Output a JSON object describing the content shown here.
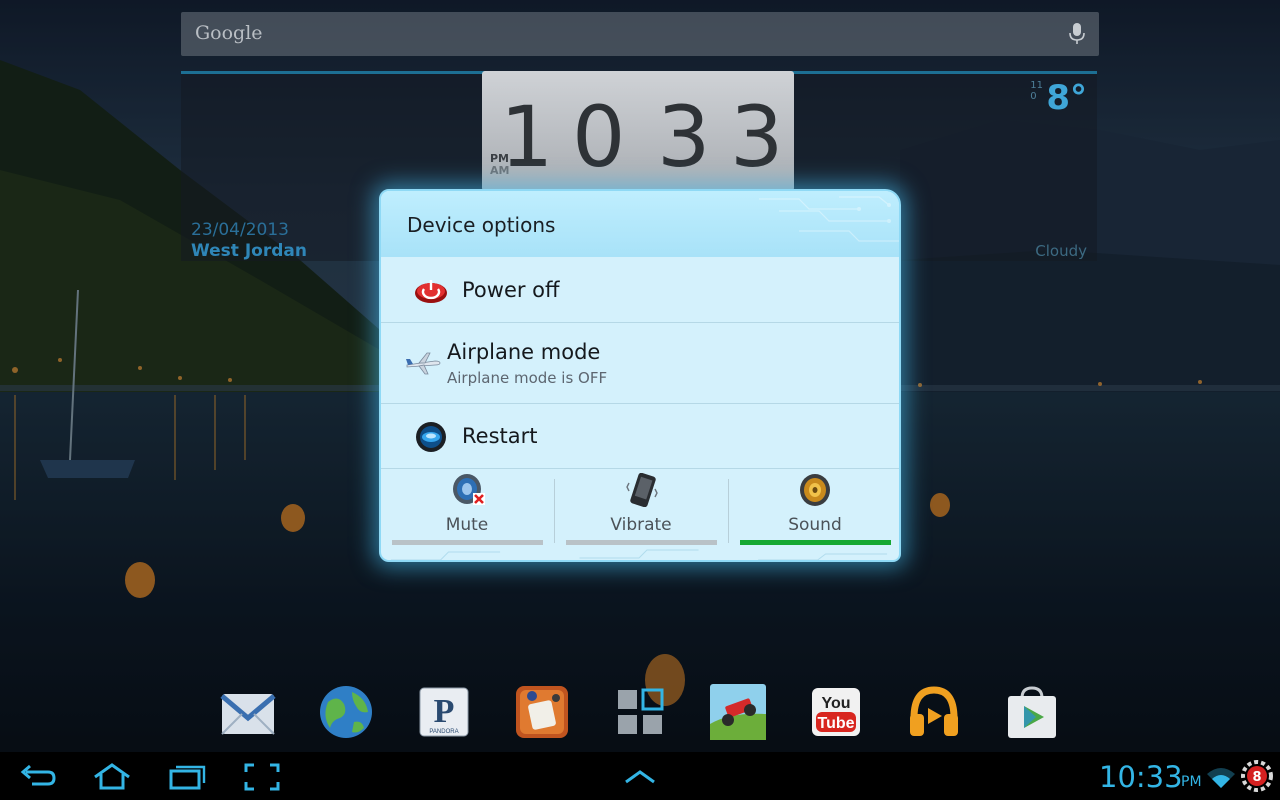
{
  "search": {
    "placeholder": "Google"
  },
  "widget": {
    "clock_digits": [
      "1",
      "0",
      "3",
      "3"
    ],
    "pm_label": "PM",
    "am_label": "AM",
    "date": "23/04/2013",
    "location": "West Jordan",
    "temperature": "8°",
    "small_digits_top": "11",
    "small_digits_bottom": "0",
    "condition": "Cloudy"
  },
  "dialog": {
    "title": "Device options",
    "options": [
      {
        "label": "Power off",
        "icon": "power-icon"
      },
      {
        "label": "Airplane mode",
        "sublabel": "Airplane mode is OFF",
        "icon": "airplane-icon"
      },
      {
        "label": "Restart",
        "icon": "restart-icon"
      }
    ],
    "profiles": [
      {
        "label": "Mute",
        "icon": "mute-speaker-icon",
        "active": false
      },
      {
        "label": "Vibrate",
        "icon": "vibrate-phone-icon",
        "active": false
      },
      {
        "label": "Sound",
        "icon": "speaker-icon",
        "active": true
      }
    ],
    "active_color": "#16a832",
    "inactive_color": "#b9c2c7"
  },
  "dock": {
    "apps": [
      {
        "name": "email-app-icon"
      },
      {
        "name": "browser-app-icon"
      },
      {
        "name": "pandora-app-icon",
        "text": "P",
        "subtext": "PANDORA"
      },
      {
        "name": "game-app-icon"
      },
      {
        "name": "app-drawer-icon"
      },
      {
        "name": "hill-climb-app-icon"
      },
      {
        "name": "youtube-app-icon",
        "text_top": "You",
        "text_bottom": "Tube"
      },
      {
        "name": "play-music-app-icon"
      },
      {
        "name": "play-store-app-icon"
      }
    ]
  },
  "status": {
    "time": "10:33",
    "ampm": "PM",
    "notification_count": "8",
    "accent": "#33b5e5"
  }
}
